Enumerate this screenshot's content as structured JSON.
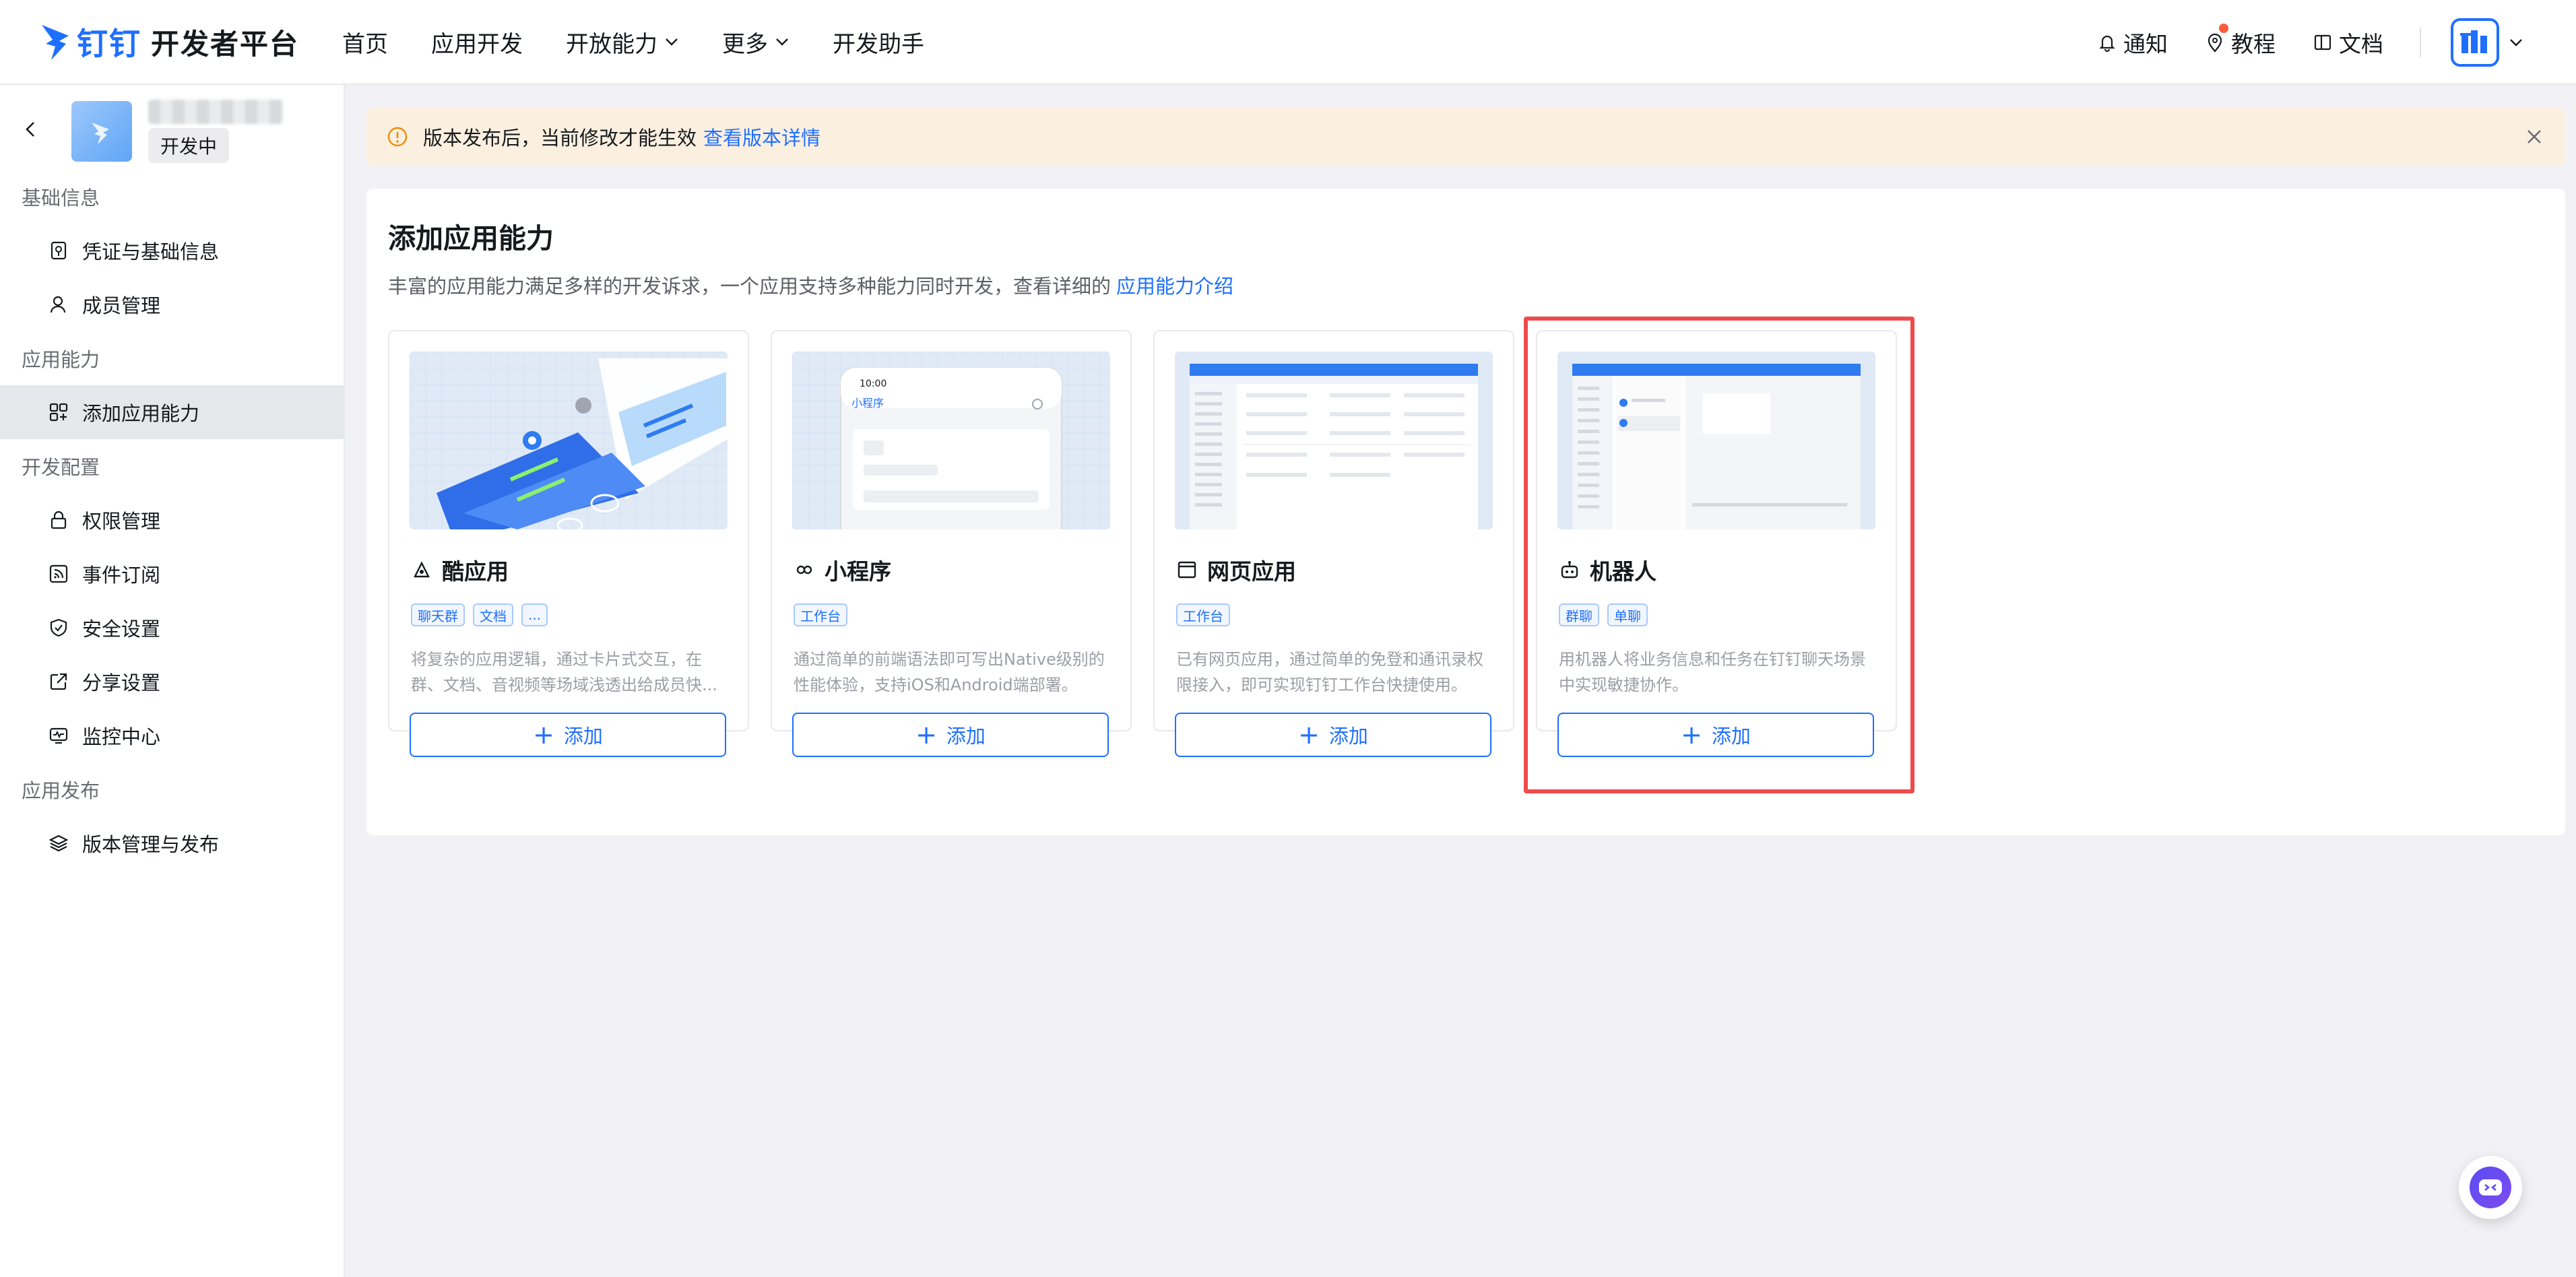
{
  "header": {
    "logo_dd": "钉钉",
    "logo_text": "开发者平台",
    "nav": [
      {
        "label": "首页"
      },
      {
        "label": "应用开发"
      },
      {
        "label": "开放能力"
      },
      {
        "label": "更多"
      },
      {
        "label": "开发助手"
      }
    ],
    "notify_label": "通知",
    "tutorial_label": "教程",
    "docs_label": "文档"
  },
  "sidebar": {
    "app_status": "开发中",
    "groups": [
      {
        "title": "基础信息",
        "items": [
          {
            "label": "凭证与基础信息",
            "icon": "credential-icon"
          },
          {
            "label": "成员管理",
            "icon": "user-icon"
          }
        ]
      },
      {
        "title": "应用能力",
        "items": [
          {
            "label": "添加应用能力",
            "icon": "grid-add-icon",
            "active": true
          }
        ]
      },
      {
        "title": "开发配置",
        "items": [
          {
            "label": "权限管理",
            "icon": "lock-icon"
          },
          {
            "label": "事件订阅",
            "icon": "rss-icon"
          },
          {
            "label": "安全设置",
            "icon": "shield-icon"
          },
          {
            "label": "分享设置",
            "icon": "share-icon"
          },
          {
            "label": "监控中心",
            "icon": "monitor-icon"
          }
        ]
      },
      {
        "title": "应用发布",
        "items": [
          {
            "label": "版本管理与发布",
            "icon": "layers-icon"
          }
        ]
      }
    ]
  },
  "banner": {
    "text": "版本发布后，当前修改才能生效",
    "link": "查看版本详情"
  },
  "main": {
    "title": "添加应用能力",
    "desc": "丰富的应用能力满足多样的开发诉求，一个应用支持多种能力同时开发，查看详细的",
    "desc_link": "应用能力介绍",
    "cards": [
      {
        "title": "酷应用",
        "icon": "cool-app-icon",
        "tags": [
          "聊天群",
          "文档",
          "..."
        ],
        "desc": "将复杂的应用逻辑，通过卡片式交互，在群、文档、音视频等场域浅透出给成员快...",
        "button": "添加"
      },
      {
        "title": "小程序",
        "icon": "miniprogram-icon",
        "tags": [
          "工作台"
        ],
        "desc": "通过简单的前端语法即可写出Native级别的性能体验，支持iOS和Android端部署。",
        "button": "添加",
        "preview_time": "10:00",
        "preview_title": "小程序"
      },
      {
        "title": "网页应用",
        "icon": "webpage-icon",
        "tags": [
          "工作台"
        ],
        "desc": "已有网页应用，通过简单的免登和通讯录权限接入，即可实现钉钉工作台快捷使用。",
        "button": "添加"
      },
      {
        "title": "机器人",
        "icon": "robot-icon",
        "tags": [
          "群聊",
          "单聊"
        ],
        "desc": "用机器人将业务信息和任务在钉钉聊天场景中实现敏捷协作。",
        "button": "添加"
      }
    ]
  },
  "colors": {
    "accent": "#1f6fff",
    "highlight": "#ee4b4b",
    "banner_bg": "#fbefe0"
  }
}
